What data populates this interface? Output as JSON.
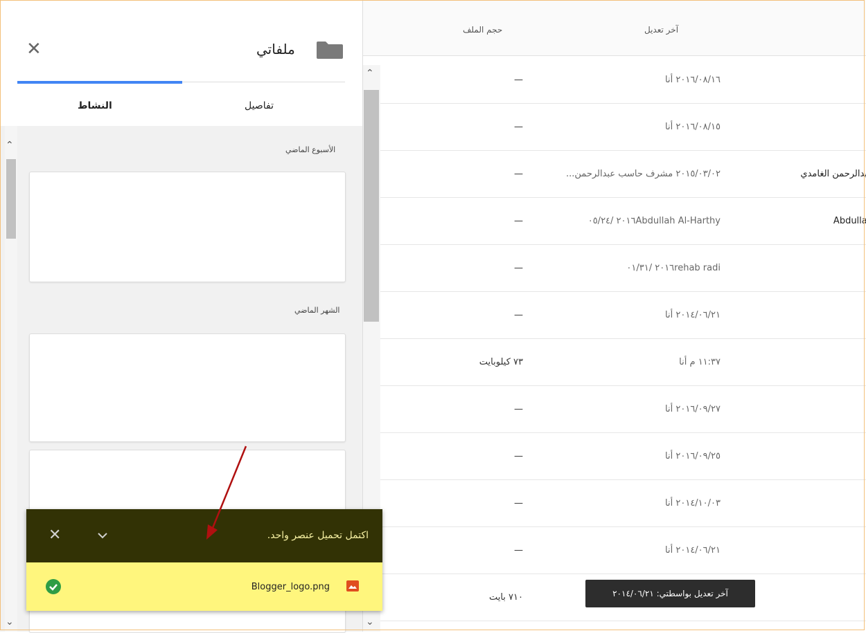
{
  "panel": {
    "title": "ملفاتي",
    "tabs": {
      "details": "تفاصيل",
      "activity": "النشاط"
    },
    "sections": {
      "last_week": "الأسبوع الماضي",
      "last_month": "الشهر الماضي"
    }
  },
  "list": {
    "headers": {
      "file_size": "حجم الملف",
      "last_modified": "آخر تعديل"
    },
    "rows": [
      {
        "size": "—",
        "modified": "٢٠١٦/٠٨/١٦ أنا",
        "owner": ""
      },
      {
        "size": "—",
        "modified": "٢٠١٦/٠٨/١٥ أنا",
        "owner": ""
      },
      {
        "size": "—",
        "modified": "٢٠١٥/٠٣/٠٢ مشرف حاسب عبدالرحمن...",
        "owner": "عبدالرحمن الغامدي"
      },
      {
        "size": "—",
        "modified": "٢٠١٦Abdullah Al-Harthy /٠٥/٢٤",
        "owner": "Abdullah"
      },
      {
        "size": "—",
        "modified": "٢٠١٦rehab radi /٠١/٣١",
        "owner": ""
      },
      {
        "size": "—",
        "modified": "٢٠١٤/٠٦/٢١ أنا",
        "owner": ""
      },
      {
        "size": "٧٣ كيلوبايت",
        "modified": "١١:٣٧ م أنا",
        "owner": ""
      },
      {
        "size": "—",
        "modified": "٢٠١٦/٠٩/٢٧ أنا",
        "owner": ""
      },
      {
        "size": "—",
        "modified": "٢٠١٦/٠٩/٢٥ أنا",
        "owner": ""
      },
      {
        "size": "—",
        "modified": "٢٠١٤/١٠/٠٣ أنا",
        "owner": ""
      },
      {
        "size": "—",
        "modified": "٢٠١٤/٠٦/٢١ أنا",
        "owner": ""
      },
      {
        "size": "٧١٠ بايت",
        "modified": "",
        "owner": ""
      }
    ],
    "tooltip": "آخر تعديل بواسطتي: ٢٠١٤/٠٦/٢١"
  },
  "toast": {
    "message": "اكتمل تحميل عنصر واحد.",
    "file_name": "Blogger_logo.png"
  },
  "colors": {
    "accent": "#4285f4",
    "toast_dark": "#323205",
    "toast_light": "#fff67d",
    "success": "#2e9d45"
  }
}
